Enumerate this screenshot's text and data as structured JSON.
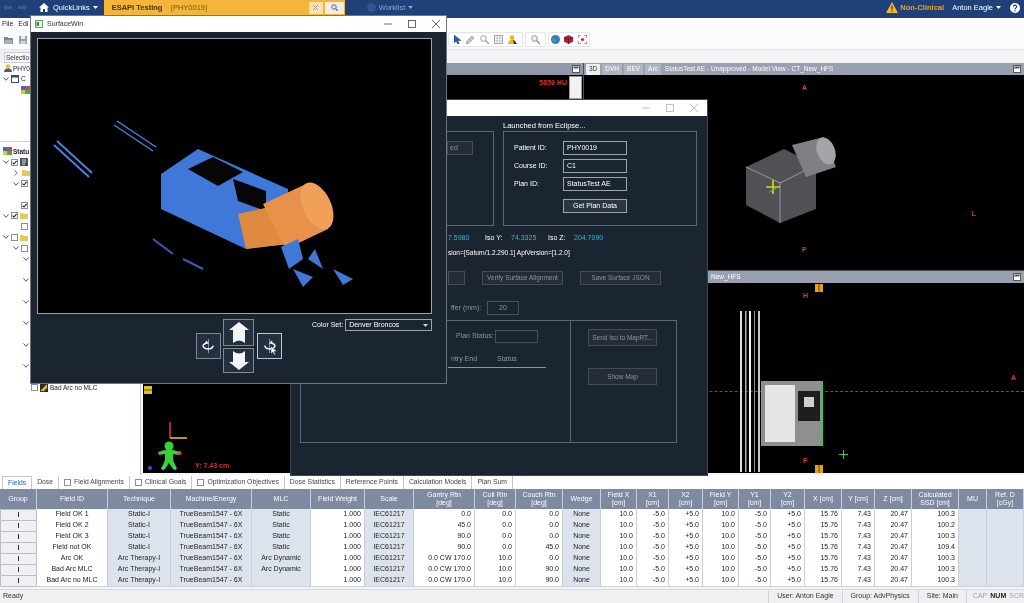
{
  "top_bar": {
    "quicklinks": "QuickLinks",
    "patient_tab": {
      "title": "ESAPI Testing",
      "patient_id": "(PHY0019)"
    },
    "worklist": {
      "label": "Worklist",
      "disabled": true
    },
    "environment": "Non-Clinical",
    "user": "Anton Eagle"
  },
  "menu": [
    "File",
    "Edi"
  ],
  "selection_tab": "Selectio",
  "patient_tree": {
    "label": "PHY0",
    "kind": "patient",
    "children": [
      {
        "label": "C",
        "kind": "image-set",
        "expanded": true,
        "children": [
          {
            "kind": "image"
          }
        ]
      }
    ]
  },
  "plan_tree": {
    "label": "Statu",
    "kind": "plan-root",
    "children": [
      {
        "kind": "plan",
        "checked": true,
        "expanded": true,
        "children": [
          {
            "kind": "folder",
            "expanded": false
          },
          {
            "kind": "item",
            "checked": true,
            "expanded": true
          },
          {
            "kind": "item",
            "checked": true
          }
        ]
      },
      {
        "kind": "folder",
        "checked": true,
        "expanded": true,
        "children": [
          {
            "kind": "item",
            "checked": false
          }
        ]
      },
      {
        "kind": "folder",
        "checked": false,
        "expanded": true,
        "children": [
          {
            "kind": "item",
            "checked": false,
            "expanded": true,
            "children": [
              {
                "kind": "field",
                "expanded": true
              },
              {
                "kind": "field",
                "expanded": true
              },
              {
                "kind": "field",
                "expanded": true
              },
              {
                "kind": "field",
                "expanded": true
              },
              {
                "kind": "field",
                "expanded": true
              },
              {
                "kind": "field",
                "expanded": true
              },
              {
                "kind": "field",
                "checked": false,
                "label": "Bad Arc no MLC"
              }
            ]
          }
        ]
      }
    ]
  },
  "left_view": {
    "hu_reading": "5859 HU",
    "position_reading": "Y: 7.43 cm"
  },
  "model_view": {
    "tabs": [
      {
        "label": "3D",
        "selected": true
      },
      {
        "label": "DVH",
        "selected": false
      },
      {
        "label": "BEV",
        "selected": false
      },
      {
        "label": "Arc",
        "selected": false
      }
    ],
    "title": "StatusTest AE - Unapproved - Model View - CT_New_HFS",
    "orientation": {
      "top": "A",
      "right": "L",
      "bottom": "P"
    }
  },
  "image_view": {
    "title": "New_HFS",
    "orientation": {
      "top": "H",
      "right": "A",
      "bottom": "F"
    }
  },
  "eclipse_dialog": {
    "load_button": {
      "label": "ed",
      "disabled": true
    },
    "launched_title": "Launched from Eclipse...",
    "fields": [
      {
        "label": "Patient ID:",
        "value": "PHY0019"
      },
      {
        "label": "Course ID:",
        "value": "C1"
      },
      {
        "label": "Plan ID:",
        "value": "StatusTest AE"
      }
    ],
    "get_plan_button": "Get Plan Data",
    "iso": [
      {
        "kind": "value",
        "text": "7.5980"
      },
      {
        "kind": "label",
        "text": "Iso Y:"
      },
      {
        "kind": "value",
        "text": "74.3325"
      },
      {
        "kind": "label",
        "text": "Iso Z:"
      },
      {
        "kind": "value",
        "text": "204.7090"
      }
    ],
    "version": "sion=[Saturn/1.2.290.1] ApiVersion=[1.2.0]",
    "actions": [
      {
        "disabled": true
      },
      {
        "label": "Verify Surface Alignment",
        "disabled": true
      },
      {
        "label": "Save Surface JSON",
        "disabled": true
      }
    ],
    "buffer": {
      "label": "ffer (mm):",
      "value": "20",
      "disabled": true
    },
    "plan_status": {
      "label": "Plan Status:",
      "disabled": true
    },
    "beam_columns": [
      "ntry End",
      "Status"
    ],
    "side_buttons": [
      {
        "label": "Send Iso to MapRT...",
        "disabled": true
      },
      {
        "label": "Show Map",
        "disabled": true
      }
    ]
  },
  "surface_window": {
    "title": "SurfaceWin",
    "color_set": {
      "label": "Color Set:",
      "value": "Denver Broncos"
    }
  },
  "plan_tabs": [
    {
      "label": "Fields",
      "kind": "plain",
      "selected": true
    },
    {
      "label": "Dose",
      "kind": "plain",
      "selected": false
    },
    {
      "label": "Field Alignments",
      "kind": "checkbox",
      "checked": false,
      "selected": false
    },
    {
      "label": "Clinical Goals",
      "kind": "checkbox",
      "checked": false,
      "selected": false
    },
    {
      "label": "Optimization Objectives",
      "kind": "checkbox",
      "checked": false,
      "selected": false
    },
    {
      "label": "Dose Statistics",
      "kind": "plain",
      "selected": false
    },
    {
      "label": "Reference Points",
      "kind": "plain",
      "selected": false
    },
    {
      "label": "Calculation Models",
      "kind": "plain",
      "selected": false
    },
    {
      "label": "Plan Sum",
      "kind": "plain",
      "selected": false
    }
  ],
  "fields_table": {
    "columns": [
      {
        "label": "Group",
        "kind": "button"
      },
      {
        "label": "Field ID",
        "kind": "text",
        "editable": true
      },
      {
        "label": "Technique",
        "kind": "text",
        "editable": false
      },
      {
        "label": "Machine/Energy",
        "kind": "text",
        "editable": false
      },
      {
        "label": "MLC",
        "kind": "text",
        "editable": false
      },
      {
        "label": "Field Weight",
        "kind": "text",
        "editable": true
      },
      {
        "label": "Scale",
        "kind": "text",
        "editable": false
      },
      {
        "label": "Gantry Rtn\n[deg]",
        "kind": "text",
        "editable": true
      },
      {
        "label": "Coll Rtn\n[deg]",
        "kind": "text",
        "editable": true
      },
      {
        "label": "Couch Rtn\n[deg]",
        "kind": "text",
        "editable": true
      },
      {
        "label": "Wedge",
        "kind": "text",
        "editable": false
      },
      {
        "label": "Field X\n[cm]",
        "kind": "text",
        "editable": true
      },
      {
        "label": "X1\n[cm]",
        "kind": "text",
        "editable": true
      },
      {
        "label": "X2\n[cm]",
        "kind": "text",
        "editable": true
      },
      {
        "label": "Field Y\n[cm]",
        "kind": "text",
        "editable": true
      },
      {
        "label": "Y1\n[cm]",
        "kind": "text",
        "editable": true
      },
      {
        "label": "Y2\n[cm]",
        "kind": "text",
        "editable": true
      },
      {
        "label": "X [cm]",
        "kind": "text",
        "editable": true
      },
      {
        "label": "Y [cm]",
        "kind": "text",
        "editable": true
      },
      {
        "label": "Z [cm]",
        "kind": "text",
        "editable": true
      },
      {
        "label": "Calculated\nSSD [cm]",
        "kind": "text",
        "editable": true
      },
      {
        "label": "MU",
        "kind": "text",
        "editable": false
      },
      {
        "label": "Ref. D\n[cGy]",
        "kind": "text",
        "editable": false
      }
    ],
    "rows": [
      [
        "",
        "Field OK 1",
        "Static-I",
        "TrueBeam1547 - 6X",
        "Static",
        "1.000",
        "IEC61217",
        "0.0",
        "0.0",
        "0.0",
        "None",
        "10.0",
        "-5.0",
        "+5.0",
        "10.0",
        "-5.0",
        "+5.0",
        "15.76",
        "7.43",
        "20.47",
        "100.3",
        "",
        ""
      ],
      [
        "",
        "Field OK 2",
        "Static-I",
        "TrueBeam1547 - 6X",
        "Static",
        "1.000",
        "IEC61217",
        "45.0",
        "0.0",
        "0.0",
        "None",
        "10.0",
        "-5.0",
        "+5.0",
        "10.0",
        "-5.0",
        "+5.0",
        "15.76",
        "7.43",
        "20.47",
        "100.2",
        "",
        ""
      ],
      [
        "",
        "Field OK 3",
        "Static-I",
        "TrueBeam1547 - 6X",
        "Static",
        "1.000",
        "IEC61217",
        "90.0",
        "0.0",
        "0.0",
        "None",
        "10.0",
        "-5.0",
        "+5.0",
        "10.0",
        "-5.0",
        "+5.0",
        "15.76",
        "7.43",
        "20.47",
        "100.3",
        "",
        ""
      ],
      [
        "",
        "Field not OK",
        "Static-I",
        "TrueBeam1547 - 6X",
        "Static",
        "1.000",
        "IEC61217",
        "90.0",
        "0.0",
        "45.0",
        "None",
        "10.0",
        "-5.0",
        "+5.0",
        "10.0",
        "-5.0",
        "+5.0",
        "15.76",
        "7.43",
        "20.47",
        "109.4",
        "",
        ""
      ],
      [
        "",
        "Arc OK",
        "Arc Therapy-I",
        "TrueBeam1547 - 6X",
        "Arc Dynamic",
        "1.000",
        "IEC61217",
        "0.0 CW 170.0",
        "10.0",
        "0.0",
        "None",
        "10.0",
        "-5.0",
        "+5.0",
        "10.0",
        "-5.0",
        "+5.0",
        "15.76",
        "7.43",
        "20.47",
        "100.3",
        "",
        ""
      ],
      [
        "",
        "Bad Arc MLC",
        "Arc Therapy-I",
        "TrueBeam1547 - 6X",
        "Arc Dynamic",
        "1.000",
        "IEC61217",
        "0.0 CW 170.0",
        "10.0",
        "90.0",
        "None",
        "10.0",
        "-5.0",
        "+5.0",
        "10.0",
        "-5.0",
        "+5.0",
        "15.76",
        "7.43",
        "20.47",
        "100.3",
        "",
        ""
      ],
      [
        "",
        "Bad Arc no MLC",
        "Arc Therapy-I",
        "TrueBeam1547 - 6X",
        "",
        "1.000",
        "IEC61217",
        "0.0 CW 170.0",
        "10.0",
        "90.0",
        "None",
        "10.0",
        "-5.0",
        "+5.0",
        "10.0",
        "-5.0",
        "+5.0",
        "15.76",
        "7.43",
        "20.47",
        "100.3",
        "",
        ""
      ]
    ]
  },
  "status_bar": {
    "message": "Ready",
    "user": "User: Anton Eagle",
    "group": "Group: AdvPhysics",
    "site": "Site: Main",
    "indicators": [
      {
        "label": "CAP",
        "on": false
      },
      {
        "label": "NUM",
        "on": true
      },
      {
        "label": "SCR",
        "on": false
      }
    ]
  }
}
